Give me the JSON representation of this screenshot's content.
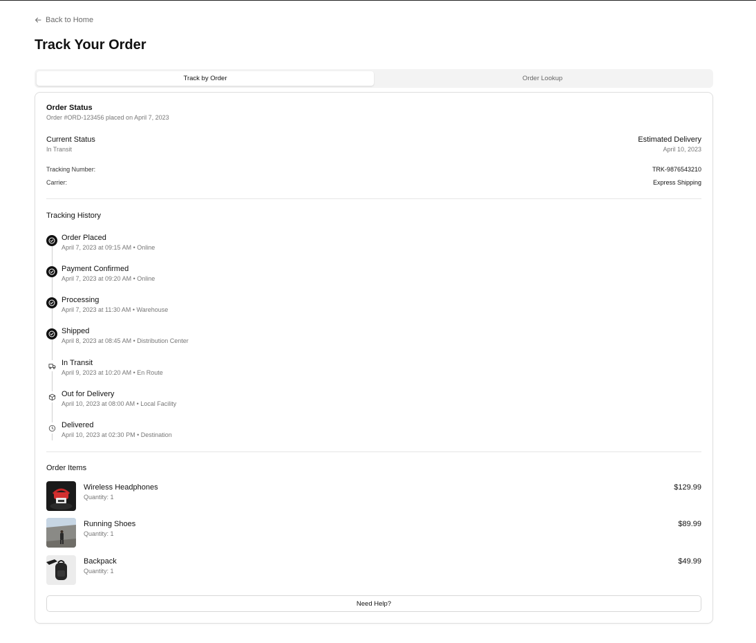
{
  "nav": {
    "back_label": "Back to Home"
  },
  "page": {
    "title": "Track Your Order"
  },
  "tabs": [
    {
      "label": "Track by Order",
      "active": true
    },
    {
      "label": "Order Lookup",
      "active": false
    }
  ],
  "order_status": {
    "heading": "Order Status",
    "subheading": "Order #ORD-123456 placed on April 7, 2023",
    "current_status_label": "Current Status",
    "current_status_value": "In Transit",
    "estimated_delivery_label": "Estimated Delivery",
    "estimated_delivery_value": "April 10, 2023",
    "tracking_number_label": "Tracking Number:",
    "tracking_number_value": "TRK-9876543210",
    "carrier_label": "Carrier:",
    "carrier_value": "Express Shipping"
  },
  "tracking_history": {
    "heading": "Tracking History",
    "events": [
      {
        "title": "Order Placed",
        "detail": "April 7, 2023 at 09:15 AM • Online",
        "state": "done",
        "icon": "check-circle-icon"
      },
      {
        "title": "Payment Confirmed",
        "detail": "April 7, 2023 at 09:20 AM • Online",
        "state": "done",
        "icon": "check-circle-icon"
      },
      {
        "title": "Processing",
        "detail": "April 7, 2023 at 11:30 AM • Warehouse",
        "state": "done",
        "icon": "check-circle-icon"
      },
      {
        "title": "Shipped",
        "detail": "April 8, 2023 at 08:45 AM • Distribution Center",
        "state": "done",
        "icon": "check-circle-icon"
      },
      {
        "title": "In Transit",
        "detail": "April 9, 2023 at 10:20 AM • En Route",
        "state": "pending",
        "icon": "truck-icon"
      },
      {
        "title": "Out for Delivery",
        "detail": "April 10, 2023 at 08:00 AM • Local Facility",
        "state": "pending",
        "icon": "package-icon"
      },
      {
        "title": "Delivered",
        "detail": "April 10, 2023 at 02:30 PM • Destination",
        "state": "pending",
        "icon": "clock-icon"
      }
    ]
  },
  "order_items": {
    "heading": "Order Items",
    "items": [
      {
        "name": "Wireless Headphones",
        "quantity": "Quantity: 1",
        "price": "$129.99"
      },
      {
        "name": "Running Shoes",
        "quantity": "Quantity: 1",
        "price": "$89.99"
      },
      {
        "name": "Backpack",
        "quantity": "Quantity: 1",
        "price": "$49.99"
      }
    ]
  },
  "help": {
    "label": "Need Help?"
  },
  "colors": {
    "accent": "#111111",
    "muted_text": "#777777",
    "border": "#dedede",
    "tab_bg": "#f3f3f3"
  }
}
